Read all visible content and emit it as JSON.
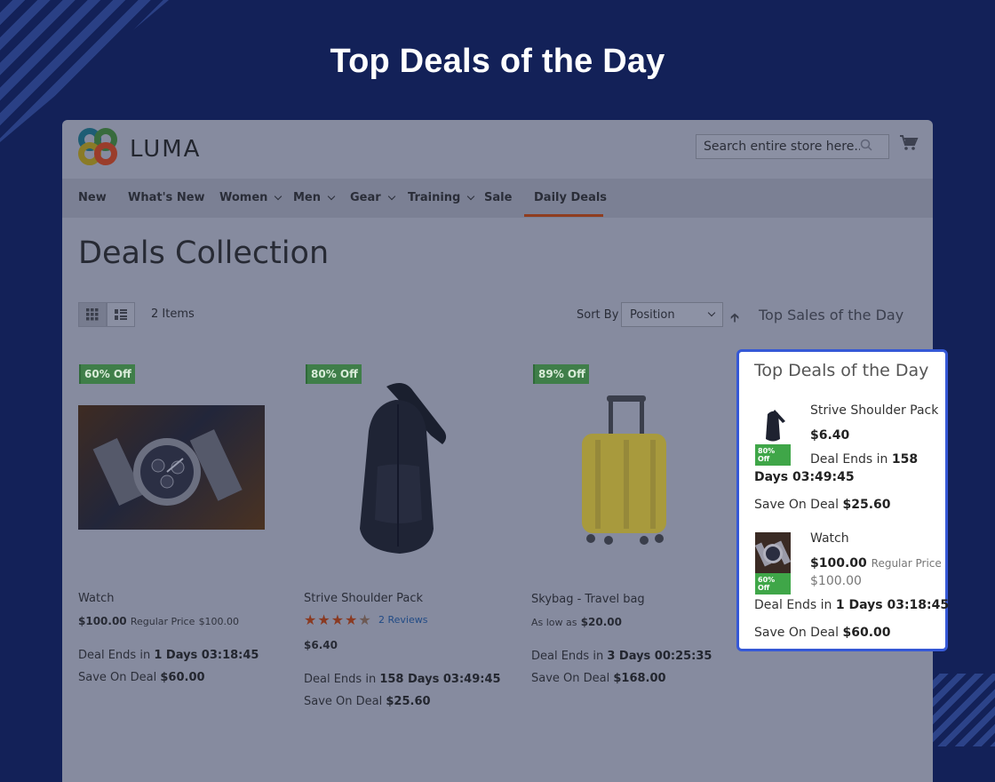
{
  "hero": {
    "title": "Top Deals of the Day"
  },
  "store": {
    "brand": "LUMA",
    "search_placeholder": "Search entire store here...",
    "nav": [
      {
        "label": "New"
      },
      {
        "label": "What's New"
      },
      {
        "label": "Women"
      },
      {
        "label": "Men"
      },
      {
        "label": "Gear"
      },
      {
        "label": "Training"
      },
      {
        "label": "Sale"
      },
      {
        "label": "Daily Deals"
      }
    ],
    "active_nav": "Daily Deals",
    "page_title": "Deals Collection",
    "toolbar": {
      "items_count": "2 Items",
      "sort_label": "Sort By",
      "sort_value": "Position",
      "top_sales_link": "Top Sales of the Day"
    },
    "products": [
      {
        "badge": "60% Off",
        "name": "Watch",
        "price": "$100.00",
        "regular_label": "Regular Price",
        "regular_price": "$100.00",
        "deal_label": "Deal Ends in",
        "deal_time": "1 Days 03:18:45",
        "save_label": "Save On Deal",
        "save_amount": "$60.00"
      },
      {
        "badge": "80% Off",
        "name": "Strive Shoulder Pack",
        "rating": 4.5,
        "reviews": "2 Reviews",
        "price": "$6.40",
        "deal_label": "Deal Ends in",
        "deal_time": "158 Days 03:49:45",
        "save_label": "Save On Deal",
        "save_amount": "$25.60"
      },
      {
        "badge": "89% Off",
        "name": "Skybag - Travel bag",
        "as_low_label": "As low as",
        "price": "$20.00",
        "deal_label": "Deal Ends in",
        "deal_time": "3 Days 00:25:35",
        "save_label": "Save On Deal",
        "save_amount": "$168.00"
      }
    ]
  },
  "deals_panel": {
    "title": "Top Deals of the Day",
    "items": [
      {
        "badge": "80% Off",
        "name": "Strive Shoulder Pack",
        "price": "$6.40",
        "deal_label": "Deal Ends in",
        "deal_time_line1": "158",
        "deal_time_line2": "Days 03:49:45",
        "save_label": "Save On Deal",
        "save_amount": "$25.60"
      },
      {
        "badge": "60% Off",
        "name": "Watch",
        "price": "$100.00",
        "regular_label": "Regular Price",
        "regular_price": "$100.00",
        "deal_label": "Deal Ends in",
        "deal_time": "1 Days 03:18:45",
        "save_label": "Save On Deal",
        "save_amount": "$60.00"
      }
    ]
  },
  "colors": {
    "background": "#132158",
    "panel_border": "#3558d6",
    "badge_green": "#3fa648",
    "star": "#e36b3e"
  }
}
